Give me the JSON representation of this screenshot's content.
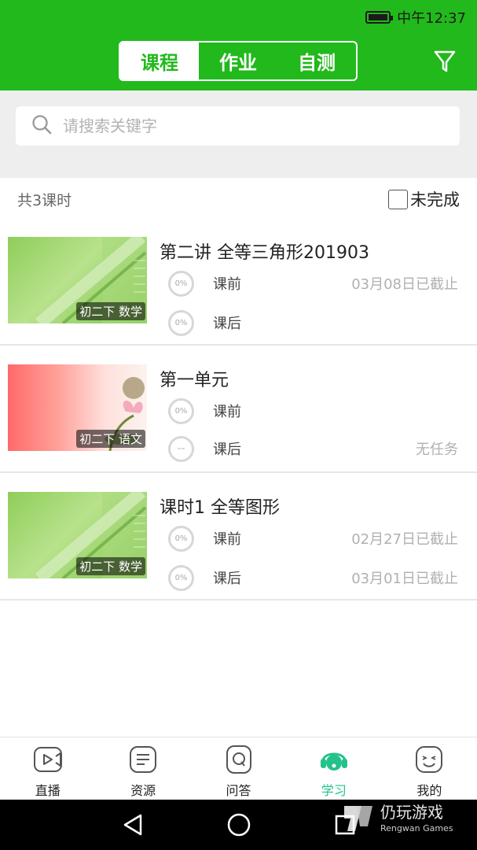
{
  "status_bar": {
    "time": "中午12:37",
    "battery_icon": "battery-icon"
  },
  "header": {
    "tabs": [
      {
        "label": "课程",
        "active": true
      },
      {
        "label": "作业",
        "active": false
      },
      {
        "label": "自测",
        "active": false
      }
    ],
    "filter_icon": "filter-icon"
  },
  "search": {
    "placeholder": "请搜索关键字",
    "icon": "search-icon"
  },
  "summary": {
    "count_text": "共3课时",
    "filter_label": "未完成",
    "filter_checked": false
  },
  "courses": [
    {
      "title": "第二讲  全等三角形201903",
      "thumb_label": "初二下 数学",
      "tasks": [
        {
          "progress": "0%",
          "label": "课前",
          "status": "03月08日已截止"
        },
        {
          "progress": "0%",
          "label": "课后",
          "status": ""
        }
      ]
    },
    {
      "title": "第一单元",
      "thumb_label": "初二下 语文",
      "tasks": [
        {
          "progress": "0%",
          "label": "课前",
          "status": ""
        },
        {
          "progress": "--",
          "label": "课后",
          "status": "无任务"
        }
      ]
    },
    {
      "title": "课时1 全等图形",
      "thumb_label": "初二下 数学",
      "tasks": [
        {
          "progress": "0%",
          "label": "课前",
          "status": "02月27日已截止"
        },
        {
          "progress": "0%",
          "label": "课后",
          "status": "03月01日已截止"
        }
      ]
    }
  ],
  "bottom_nav": [
    {
      "label": "直播",
      "icon": "video-icon",
      "active": false
    },
    {
      "label": "资源",
      "icon": "document-icon",
      "active": false
    },
    {
      "label": "问答",
      "icon": "question-icon",
      "active": false
    },
    {
      "label": "学习",
      "icon": "headset-icon",
      "active": true
    },
    {
      "label": "我的",
      "icon": "smiley-icon",
      "active": false
    }
  ],
  "watermark": {
    "name": "仍玩游戏",
    "sub": "Rengwan Games"
  },
  "colors": {
    "brand": "#22b91c",
    "active_nav": "#22c28a"
  }
}
